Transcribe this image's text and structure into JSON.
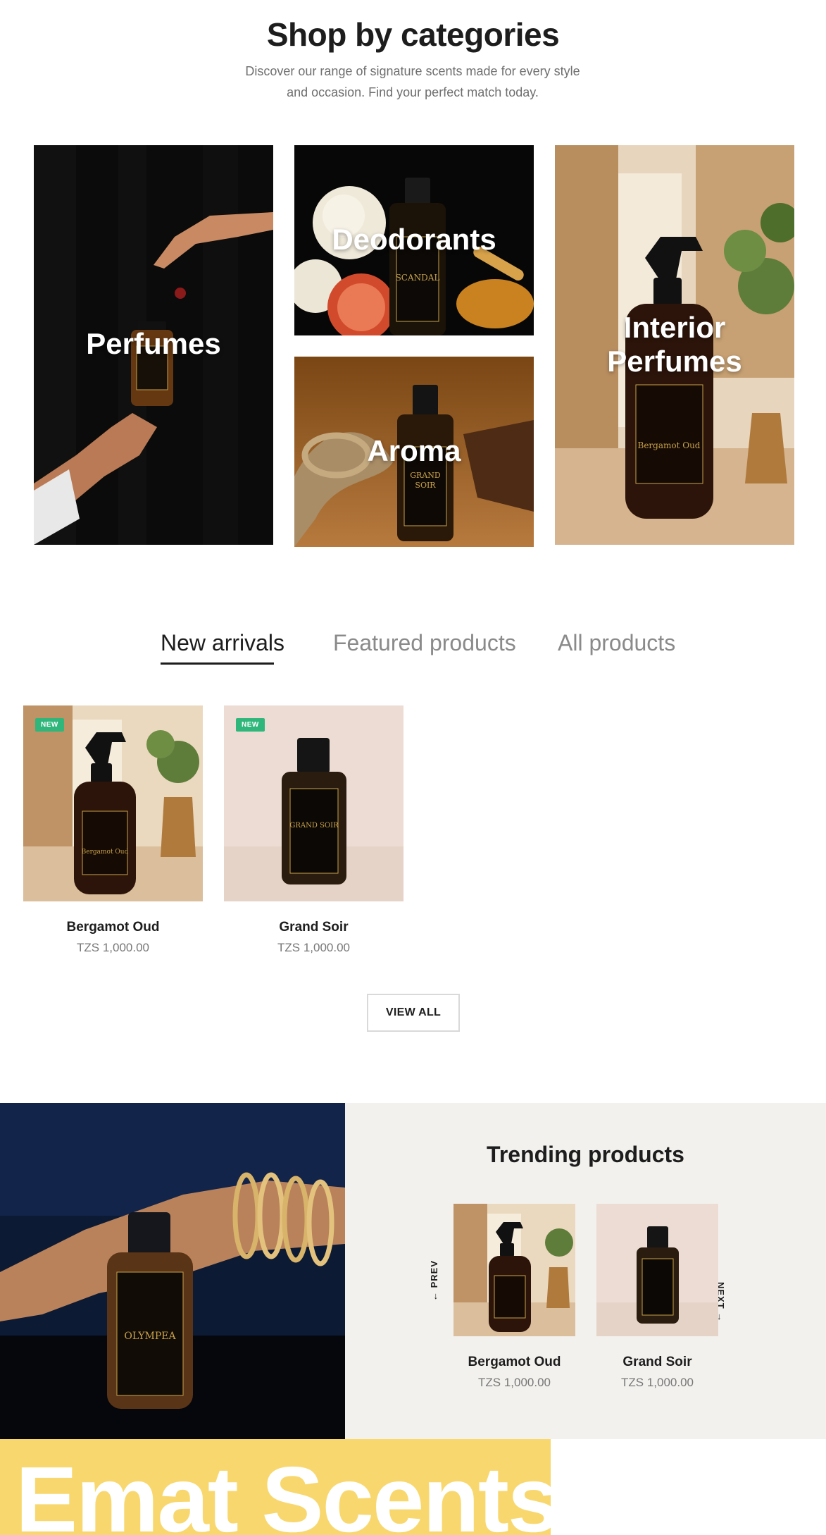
{
  "categories_section": {
    "title": "Shop by categories",
    "subtitle": "Discover our range of signature scents made for every style and occasion. Find your perfect match today.",
    "tiles": [
      {
        "label": "Perfumes"
      },
      {
        "label": "Deodorants"
      },
      {
        "label": "Aroma"
      },
      {
        "label": "Interior Perfumes"
      }
    ]
  },
  "tabs": [
    {
      "label": "New arrivals",
      "active": true
    },
    {
      "label": "Featured products",
      "active": false
    },
    {
      "label": "All products",
      "active": false
    }
  ],
  "products": [
    {
      "name": "Bergamot Oud",
      "price": "TZS 1,000.00",
      "badge": "NEW",
      "bottle_text": "Bergamot Oud"
    },
    {
      "name": "Grand Soir",
      "price": "TZS 1,000.00",
      "badge": "NEW",
      "bottle_text": "GRAND SOIR"
    }
  ],
  "view_all_label": "VIEW ALL",
  "trending": {
    "title": "Trending products",
    "prev_label": "← PREV",
    "next_label": "NEXT →",
    "items": [
      {
        "name": "Bergamot Oud",
        "price": "TZS 1,000.00"
      },
      {
        "name": "Grand Soir",
        "price": "TZS 1,000.00"
      }
    ],
    "hero_bottle_text": "OLYMPEA"
  },
  "brand_banner": "Emat Scents",
  "logo": {
    "line1": "EMAT",
    "line2": "SCENTS"
  },
  "colors": {
    "accent_green": "#2fb67a",
    "banner_yellow": "#f8d86e",
    "trend_bg": "#f3f1ee",
    "gold": "#c9a24a"
  }
}
